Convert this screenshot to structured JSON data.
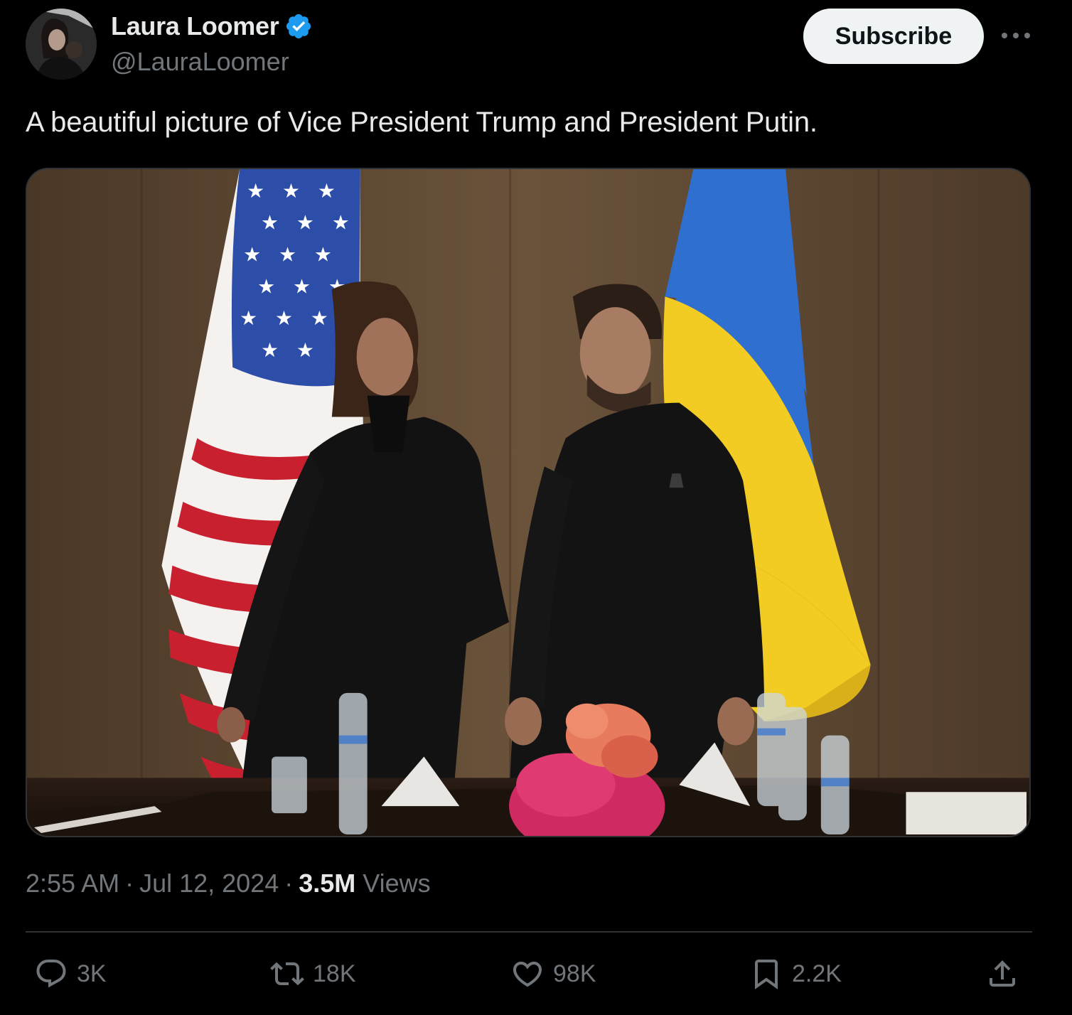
{
  "author": {
    "display_name": "Laura Loomer",
    "handle": "@LauraLoomer",
    "verified": true,
    "verified_color": "#1d9bf0"
  },
  "header": {
    "subscribe_label": "Subscribe",
    "more_icon": "ellipsis-icon"
  },
  "tweet": {
    "text": "A beautiful picture of Vice President Trump and President Putin."
  },
  "meta": {
    "time": "2:55 AM",
    "separator": "·",
    "date": "Jul 12, 2024",
    "views_count": "3.5M",
    "views_label": "Views"
  },
  "actions": {
    "replies": {
      "icon": "reply-icon",
      "count": "3K"
    },
    "reposts": {
      "icon": "repost-icon",
      "count": "18K"
    },
    "likes": {
      "icon": "heart-icon",
      "count": "98K"
    },
    "bookmarks": {
      "icon": "bookmark-icon",
      "count": "2.2K"
    },
    "share": {
      "icon": "share-icon"
    }
  },
  "colors": {
    "background": "#000000",
    "primary_text": "#e7e9ea",
    "secondary_text": "#71767b",
    "divider": "#2f3336"
  }
}
